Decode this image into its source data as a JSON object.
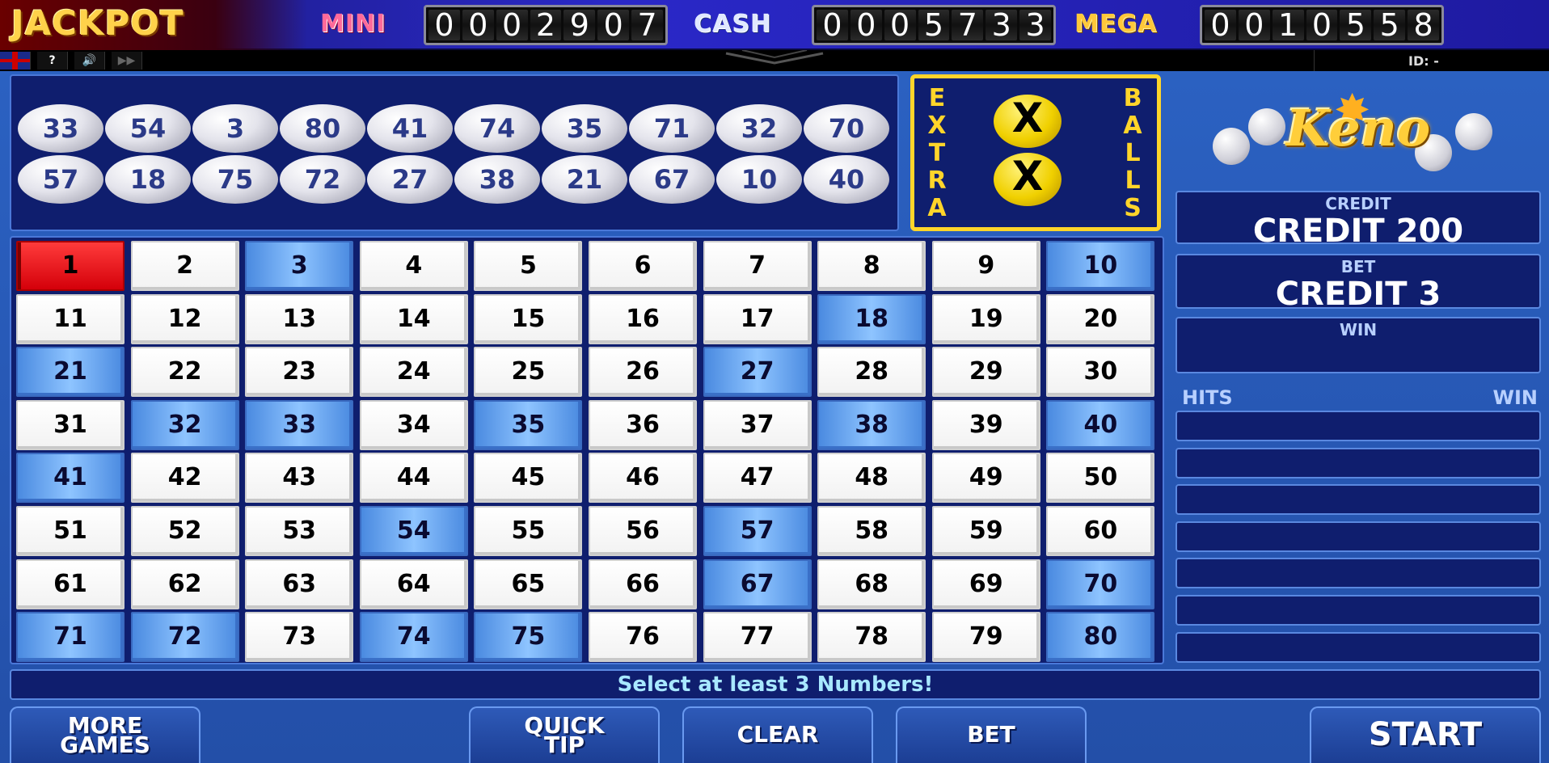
{
  "jackpot": {
    "title": "JACKPOT",
    "mini": {
      "label": "MINI",
      "value": "0002907"
    },
    "cash": {
      "label": "CASH",
      "value": "0005733"
    },
    "mega": {
      "label": "MEGA",
      "value": "0010558"
    }
  },
  "subbar": {
    "help": "?",
    "sound": "🔊",
    "fast": "▶▶",
    "id": "ID: -"
  },
  "drawn_balls": {
    "row1": [
      "33",
      "54",
      "3",
      "80",
      "41",
      "74",
      "35",
      "71",
      "32",
      "70"
    ],
    "row2": [
      "57",
      "18",
      "75",
      "72",
      "27",
      "38",
      "21",
      "67",
      "10",
      "40"
    ]
  },
  "extra_balls": {
    "left_text": "EXTRA",
    "right_text": "BALLS",
    "ball_symbol": "X"
  },
  "board": {
    "drawn": [
      3,
      10,
      18,
      21,
      27,
      32,
      33,
      35,
      38,
      40,
      41,
      54,
      57,
      67,
      70,
      71,
      72,
      74,
      75,
      80
    ],
    "selected": [
      1
    ]
  },
  "logo": {
    "text": "Keno"
  },
  "panel": {
    "credit_label": "CREDIT",
    "credit_value": "CREDIT 200",
    "bet_label": "BET",
    "bet_value": "CREDIT 3",
    "win_label": "WIN",
    "win_value": "",
    "hits_label": "HITS",
    "hits_win_label": "WIN"
  },
  "message": "Select at least 3 Numbers!",
  "buttons": {
    "more_games_1": "MORE",
    "more_games_2": "GAMES",
    "quick_tip_1": "QUICK",
    "quick_tip_2": "TIP",
    "clear": "CLEAR",
    "bet": "BET",
    "start": "START"
  },
  "colors": {
    "drawn": "#7ab4f8",
    "selected": "#e0101a",
    "panel": "#0f1e6e",
    "accent": "#ffd52a"
  }
}
